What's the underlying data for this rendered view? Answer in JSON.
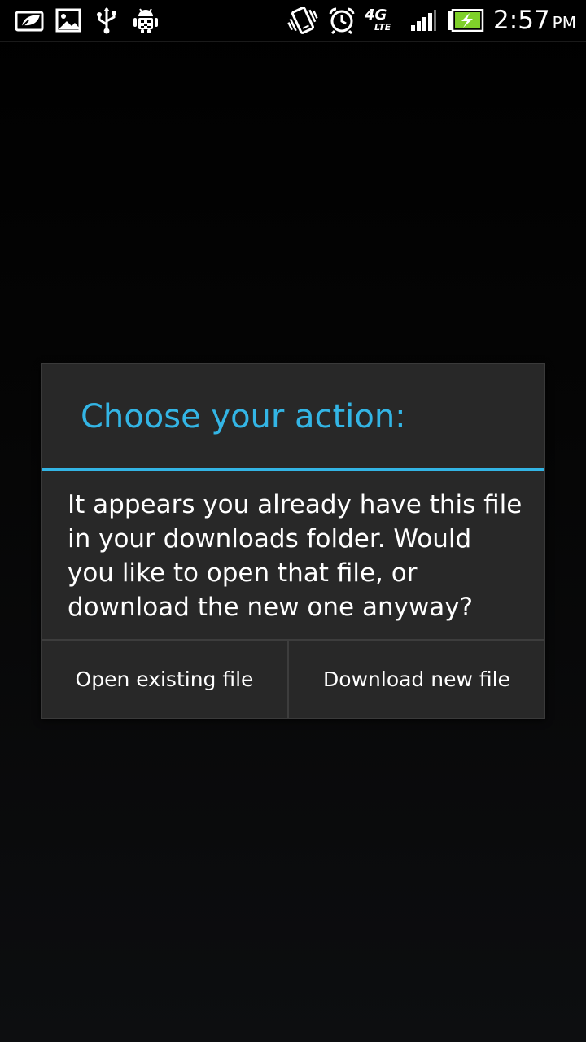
{
  "status_bar": {
    "left_icons": [
      "notification-leaf-icon",
      "gallery-image-icon",
      "usb-icon",
      "android-debug-icon"
    ],
    "right_icons": [
      "vibrate-icon",
      "alarm-clock-icon",
      "network-4g-lte-icon",
      "signal-strength-icon",
      "battery-charging-icon"
    ],
    "network_label": "4G",
    "network_sub": "LTE",
    "time": "2:57",
    "ampm": "PM"
  },
  "dialog": {
    "title": "Choose your action:",
    "message": "It appears you already have this file in your downloads folder. Would you like to open that file, or download the new one anyway?",
    "buttons": {
      "open_existing": "Open existing file",
      "download_new": "Download new file"
    }
  },
  "colors": {
    "accent": "#33b5e5",
    "dialog_bg": "#282828",
    "text": "#ffffff"
  }
}
